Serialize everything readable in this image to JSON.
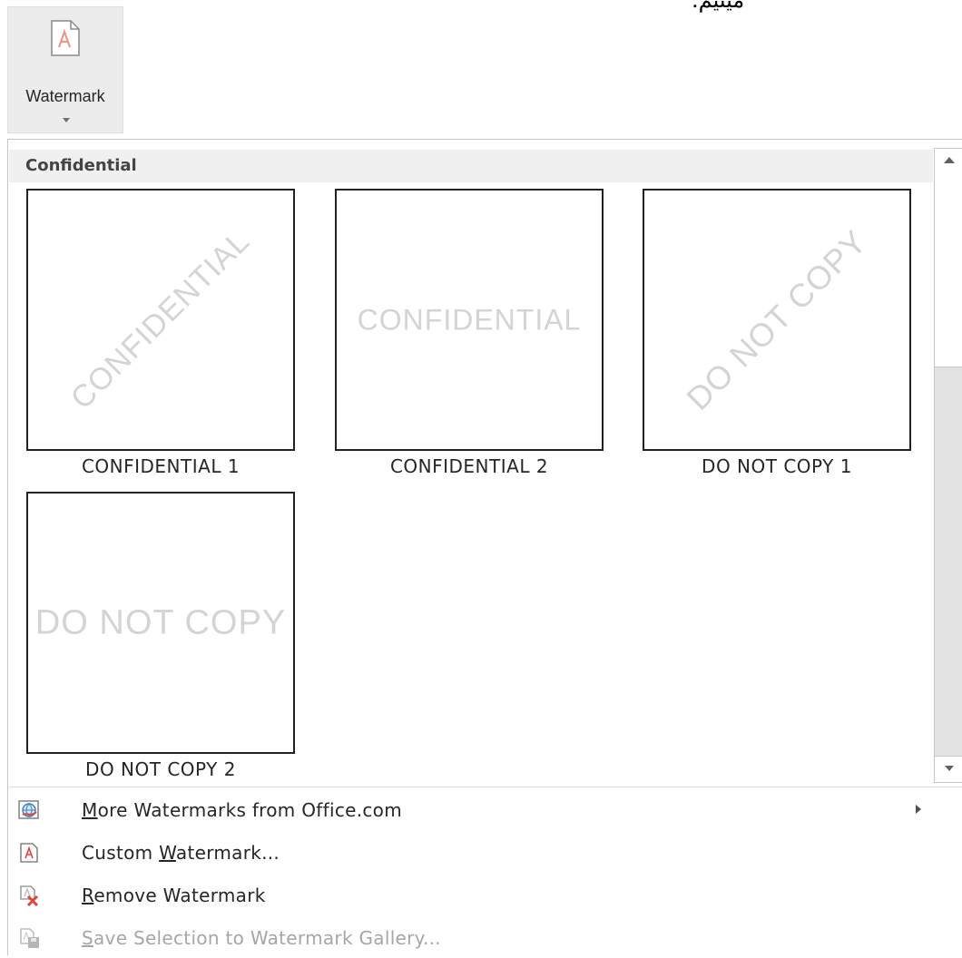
{
  "top_fragment": "ميتيم.",
  "ribbon": {
    "watermark_label": "Watermark"
  },
  "gallery": {
    "section_title": "Confidential",
    "items": [
      {
        "caption": "CONFIDENTIAL 1",
        "watermark_text": "CONFIDENTIAL",
        "orientation": "diagonal"
      },
      {
        "caption": "CONFIDENTIAL 2",
        "watermark_text": "CONFIDENTIAL",
        "orientation": "horizontal"
      },
      {
        "caption": "DO NOT COPY 1",
        "watermark_text": "DO NOT COPY",
        "orientation": "diagonal"
      },
      {
        "caption": "DO NOT COPY 2",
        "watermark_text": "DO NOT COPY",
        "orientation": "horizontal"
      }
    ]
  },
  "menu": {
    "more_watermarks": {
      "pre": "",
      "accel": "M",
      "post": "ore Watermarks from Office.com",
      "icon": "globe-icon"
    },
    "custom_watermark": {
      "pre": "Custom ",
      "accel": "W",
      "post": "atermark...",
      "icon": "watermark-doc-icon"
    },
    "remove_watermark": {
      "pre": "",
      "accel": "R",
      "post": "emove Watermark",
      "icon": "remove-icon"
    },
    "save_selection": {
      "pre": "",
      "accel": "S",
      "post": "ave Selection to Watermark Gallery...",
      "icon": "save-gallery-icon",
      "disabled": true
    }
  },
  "colors": {
    "header_bg": "#f0f0f0",
    "watermark_gray": "#d4d4d4",
    "icon_red": "#e0463a",
    "disabled_text": "#a6a6a6"
  }
}
